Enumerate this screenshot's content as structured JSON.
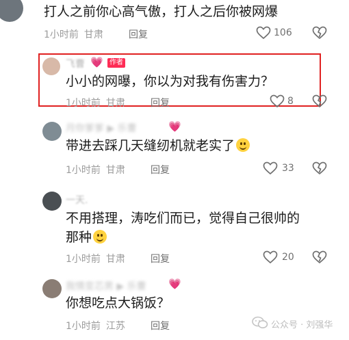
{
  "comments": [
    {
      "text": "打人之前你心高气傲，打人之后你被网爆",
      "time": "1小时前",
      "location": "甘肃",
      "reply_label": "回复",
      "likes": "106"
    },
    {
      "username": "飞曹",
      "author_tag": "作者",
      "text": "小小的网曝，你以为对我有伤害力？",
      "time": "1小时前",
      "location": "甘肃",
      "reply_label": "回复",
      "likes": "8"
    },
    {
      "username": "月你爹爹 ▶ 乐曹",
      "text": "带进去踩几天缝纫机就老实了",
      "time": "1小时前",
      "location": "甘肃",
      "reply_label": "回复",
      "likes": "33"
    },
    {
      "username": "一天.",
      "text_line1": "不用搭理，涛吃们而已，觉得自己很帅的",
      "text_line2": "那种",
      "time": "1小时前",
      "location": "甘肃",
      "reply_label": "回复",
      "likes": "20"
    },
    {
      "username": "我情变芯男 ▶ 乐曹",
      "text": "你想吃点大锅饭？",
      "time": "1小时前",
      "location": "江苏",
      "reply_label": "回复"
    }
  ],
  "watermark": "公众号 · 刘强华",
  "colors": {
    "highlight": "#e02020",
    "author_tag": "#fe2c55",
    "meta": "#9b9b9b"
  },
  "icons": [
    "heart-outline-icon",
    "broken-heart-icon",
    "wechat-icon",
    "emoji-icon"
  ]
}
